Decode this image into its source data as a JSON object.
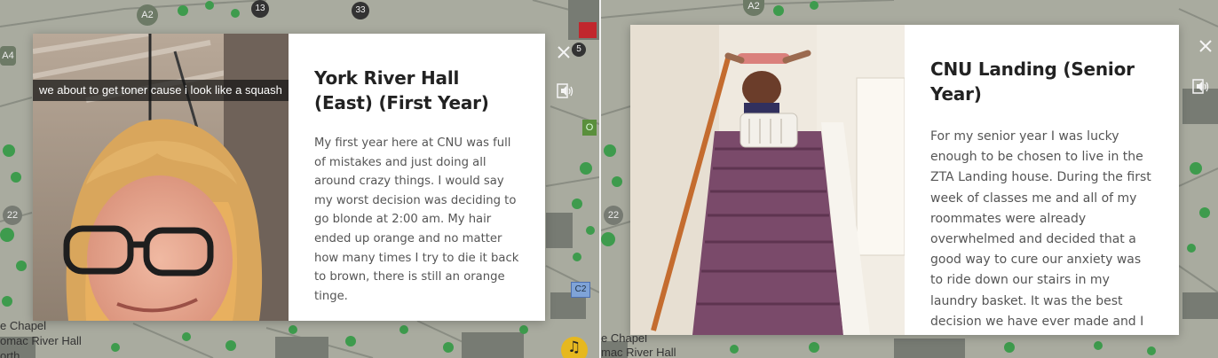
{
  "left_panel": {
    "map": {
      "building_labels": [
        "A2",
        "13",
        "33",
        "A4",
        "22",
        "5",
        "O",
        "C2"
      ],
      "place_labels": [
        "e Chapel",
        "omac River Hall",
        "orth"
      ]
    },
    "story": {
      "title": "York River Hall (East) (First Year)",
      "photo_caption": "we about to get toner cause i look like a squash",
      "body": "My first year here at CNU was full of mistakes and just doing all around crazy things. I would say my worst decision was deciding to go blonde at 2:00 am. My hair ended up orange and no matter how many times I try to die it back to brown, there is still an orange tinge."
    },
    "controls": {
      "close_icon": "close-icon",
      "audio_icon": "speaker-icon",
      "music_icon": "music-note-icon",
      "music_glyph": "♫"
    }
  },
  "right_panel": {
    "map": {
      "building_labels": [
        "A2",
        "22"
      ],
      "place_labels": [
        "e Chapel",
        "mac River Hall"
      ]
    },
    "story": {
      "title": "CNU Landing (Senior Year)",
      "body": "For my senior year I was lucky enough to be chosen to live in the ZTA Landing house. During the first week of classes me and all of my roommates were already overwhelmed and decided that a good way to cure our anxiety was to ride down our stairs in my laundry basket. It was the best decision we have ever made and I can guarantee"
    },
    "controls": {
      "close_icon": "close-icon",
      "audio_icon": "speaker-icon"
    }
  },
  "colors": {
    "map_bg": "#a9ab9f",
    "map_green": "#3e9b4d",
    "building_gray": "#777b73",
    "modal_bg": "#ffffff",
    "title": "#222222",
    "body_text": "#555555",
    "music_button": "#e6b81f"
  }
}
